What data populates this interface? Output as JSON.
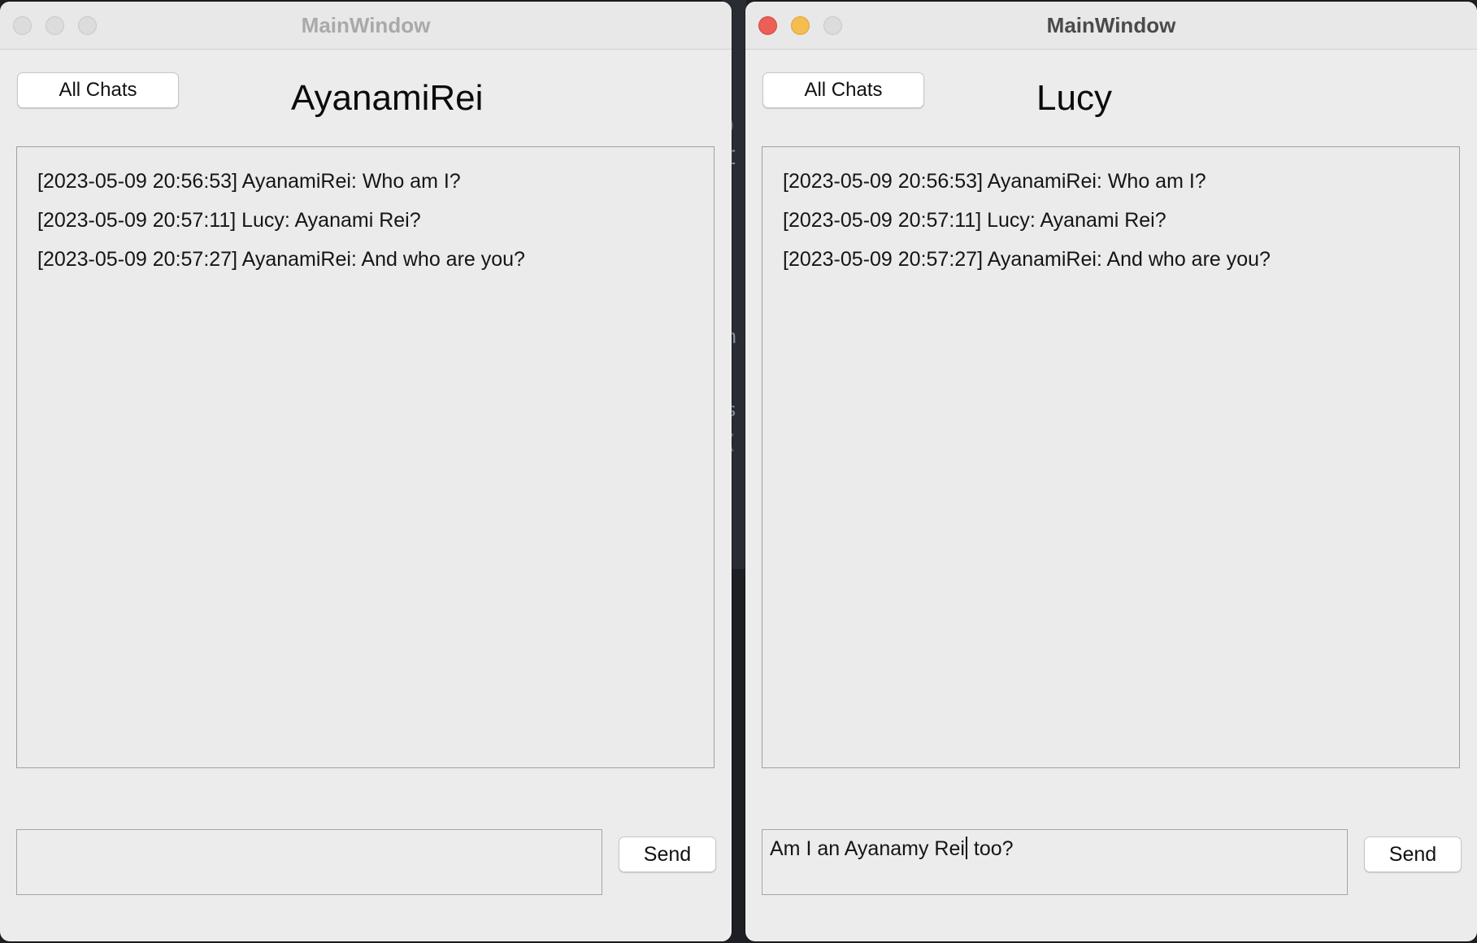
{
  "windows": {
    "left": {
      "title": "MainWindow",
      "all_chats_label": "All Chats",
      "chat_title": "AyanamiRei",
      "messages": [
        "[2023-05-09 20:56:53] AyanamiRei: Who am I?",
        "[2023-05-09 20:57:11] Lucy: Ayanami Rei?",
        "[2023-05-09 20:57:27] AyanamiRei: And who are you?"
      ],
      "input_value": "",
      "send_label": "Send"
    },
    "right": {
      "title": "MainWindow",
      "all_chats_label": "All Chats",
      "chat_title": "Lucy",
      "messages": [
        "[2023-05-09 20:56:53] AyanamiRei: Who am I?",
        "[2023-05-09 20:57:11] Lucy: Ayanami Rei?",
        "[2023-05-09 20:57:27] AyanamiRei: And who are you?"
      ],
      "input_before_cursor": "Am I an Ayanamy Rei",
      "input_after_cursor": " too?",
      "send_label": "Send"
    }
  },
  "colors": {
    "close": "#ec5f57",
    "minimize": "#f5bd4f",
    "inactive_light": "#dcdcdc",
    "window_bg": "#ececec"
  }
}
